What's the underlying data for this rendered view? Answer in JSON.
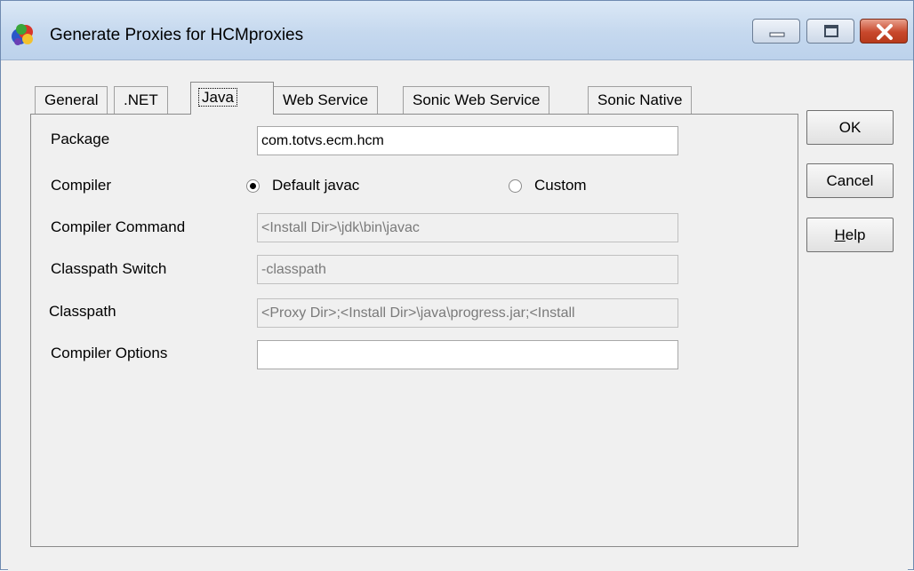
{
  "window": {
    "title": "Generate Proxies for HCMproxies"
  },
  "tabs": [
    {
      "label": "General",
      "active": false
    },
    {
      "label": ".NET",
      "active": false
    },
    {
      "label": "Java",
      "active": true
    },
    {
      "label": "Web Service",
      "active": false
    },
    {
      "label": "Sonic Web Service",
      "active": false
    },
    {
      "label": "Sonic Native",
      "active": false
    }
  ],
  "form": {
    "package_label": "Package",
    "package_value": "com.totvs.ecm.hcm",
    "compiler_label": "Compiler",
    "compiler_option_default": "Default javac",
    "compiler_option_custom": "Custom",
    "compiler_selected": "Default javac",
    "compiler_command_label": "Compiler Command",
    "compiler_command_value": "<Install Dir>\\jdk\\bin\\javac",
    "classpath_switch_label": "Classpath Switch",
    "classpath_switch_value": "-classpath",
    "classpath_label": "Classpath",
    "classpath_value": "<Proxy Dir>;<Install Dir>\\java\\progress.jar;<Install",
    "compiler_options_label": "Compiler Options",
    "compiler_options_value": ""
  },
  "buttons": {
    "ok": "OK",
    "cancel": "Cancel",
    "help": "Help"
  },
  "icons": {
    "app": "proxy-generator-icon",
    "minimize": "minimize-icon",
    "maximize": "maximize-icon",
    "close": "close-icon"
  },
  "colors": {
    "close_button": "#c8482c",
    "titlebar": "#c5d8ee",
    "dialog_background": "#f0f0f0"
  }
}
